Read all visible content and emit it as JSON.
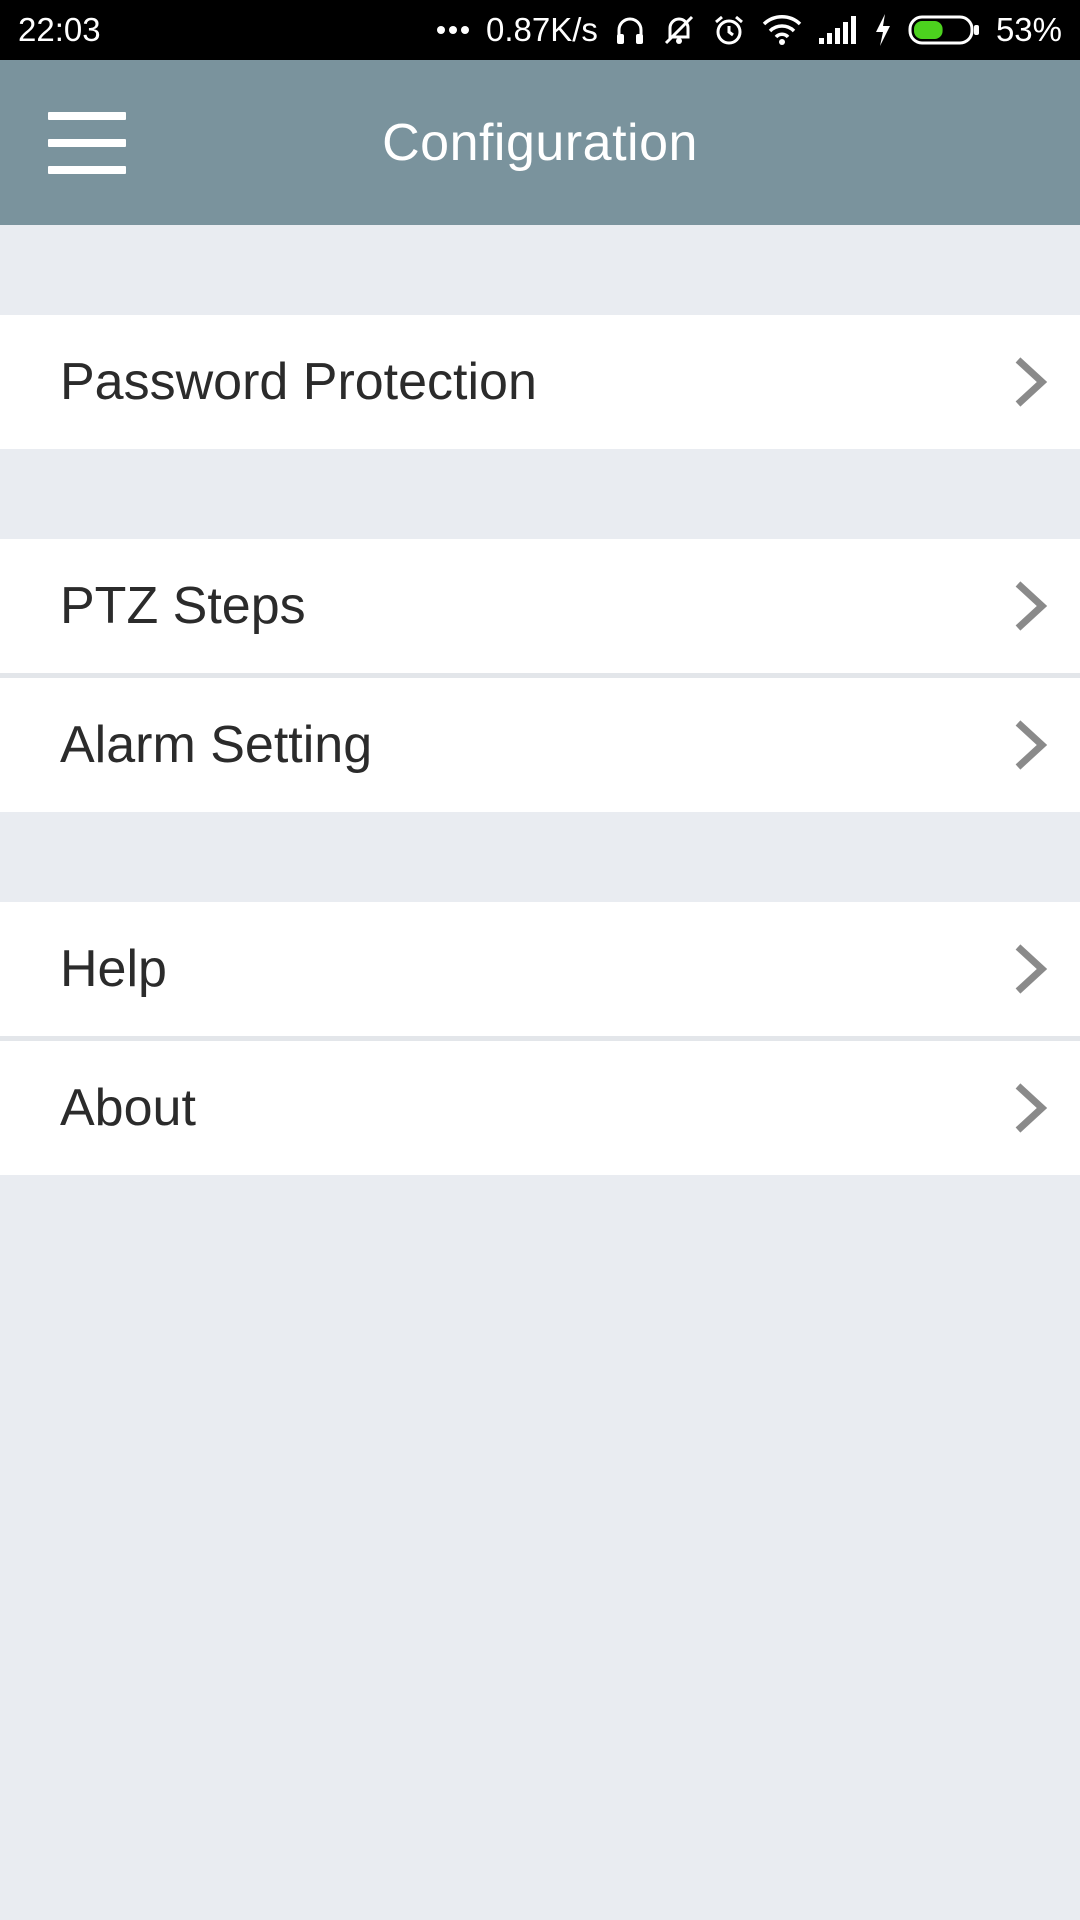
{
  "status_bar": {
    "time": "22:03",
    "net_speed": "0.87K/s",
    "battery": "53%",
    "icons": [
      "more-dots-icon",
      "headphones-icon",
      "silent-icon",
      "alarm-clock-icon",
      "wifi-icon",
      "cell-signal-icon",
      "charging-bolt-icon",
      "battery-icon"
    ]
  },
  "app_bar": {
    "title": "Configuration",
    "menu_icon": "hamburger-menu-icon"
  },
  "groups": [
    {
      "items": [
        {
          "label": "Password Protection"
        }
      ]
    },
    {
      "items": [
        {
          "label": "PTZ Steps"
        },
        {
          "label": "Alarm Setting"
        }
      ]
    },
    {
      "items": [
        {
          "label": "Help"
        },
        {
          "label": "About"
        }
      ]
    }
  ],
  "colors": {
    "app_bar": "#7a939d",
    "background": "#e9ecf1",
    "row": "#ffffff",
    "text": "#2b2b2b",
    "chevron": "#8a8a8a",
    "battery_fill": "#4cd21e"
  }
}
